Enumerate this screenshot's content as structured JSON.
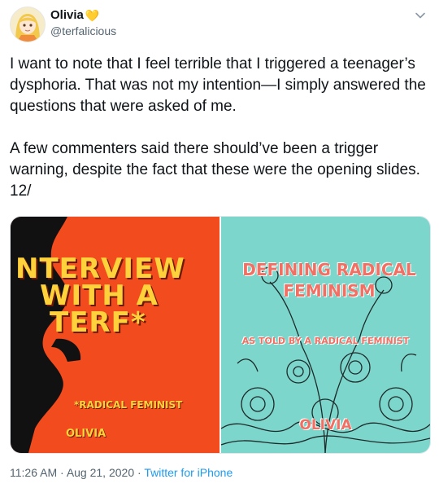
{
  "user": {
    "display_name": "Olivia",
    "name_emoji": "💛",
    "handle": "@terfalicious"
  },
  "menu": {
    "caret_icon": "chevron-down-icon"
  },
  "tweet": {
    "text": "I want to note that I feel terrible that I triggered a teenager’s dysphoria. That was not my intention—I simply answered the questions that were asked of me.\n\nA few commenters said there should’ve been a trigger warning, despite the fact that these were the opening slides. 12/"
  },
  "media": {
    "left": {
      "title_line1": "NTERVIEW",
      "title_line2": "WITH A",
      "title_line3": "TERF*",
      "subtitle": "*RADICAL FEMINIST",
      "author": "OLIVIA",
      "bg_color": "#f24b1e",
      "text_color": "#ffd23c"
    },
    "right": {
      "title": "DEFINING RADICAL FEMINISM",
      "subtitle": "AS TOLD BY A RADICAL FEMINIST",
      "author": "OLIVIA",
      "bg_color": "#7dd6cc",
      "text_color": "#f26f63"
    }
  },
  "meta": {
    "time": "11:26 AM",
    "separator": "·",
    "date": "Aug 21, 2020",
    "source": "Twitter for iPhone"
  }
}
